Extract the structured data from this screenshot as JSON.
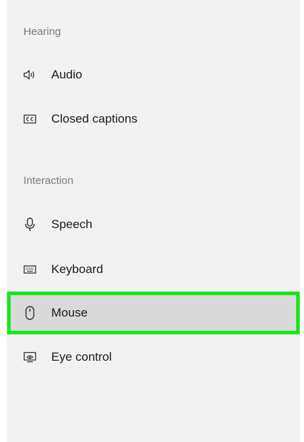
{
  "sections": {
    "hearing": {
      "header": "Hearing",
      "items": [
        {
          "label": "Audio",
          "icon": "speaker-icon"
        },
        {
          "label": "Closed captions",
          "icon": "closed-captions-icon"
        }
      ]
    },
    "interaction": {
      "header": "Interaction",
      "items": [
        {
          "label": "Speech",
          "icon": "microphone-icon"
        },
        {
          "label": "Keyboard",
          "icon": "keyboard-icon"
        },
        {
          "label": "Mouse",
          "icon": "mouse-icon",
          "selected": true
        },
        {
          "label": "Eye control",
          "icon": "eye-control-icon"
        }
      ]
    }
  },
  "colors": {
    "panel_background": "#f2f2f2",
    "selected_background": "#d9d9d9",
    "highlight_border": "#19e619",
    "header_text": "#7a7a7a",
    "item_text": "#1a1a1a"
  }
}
